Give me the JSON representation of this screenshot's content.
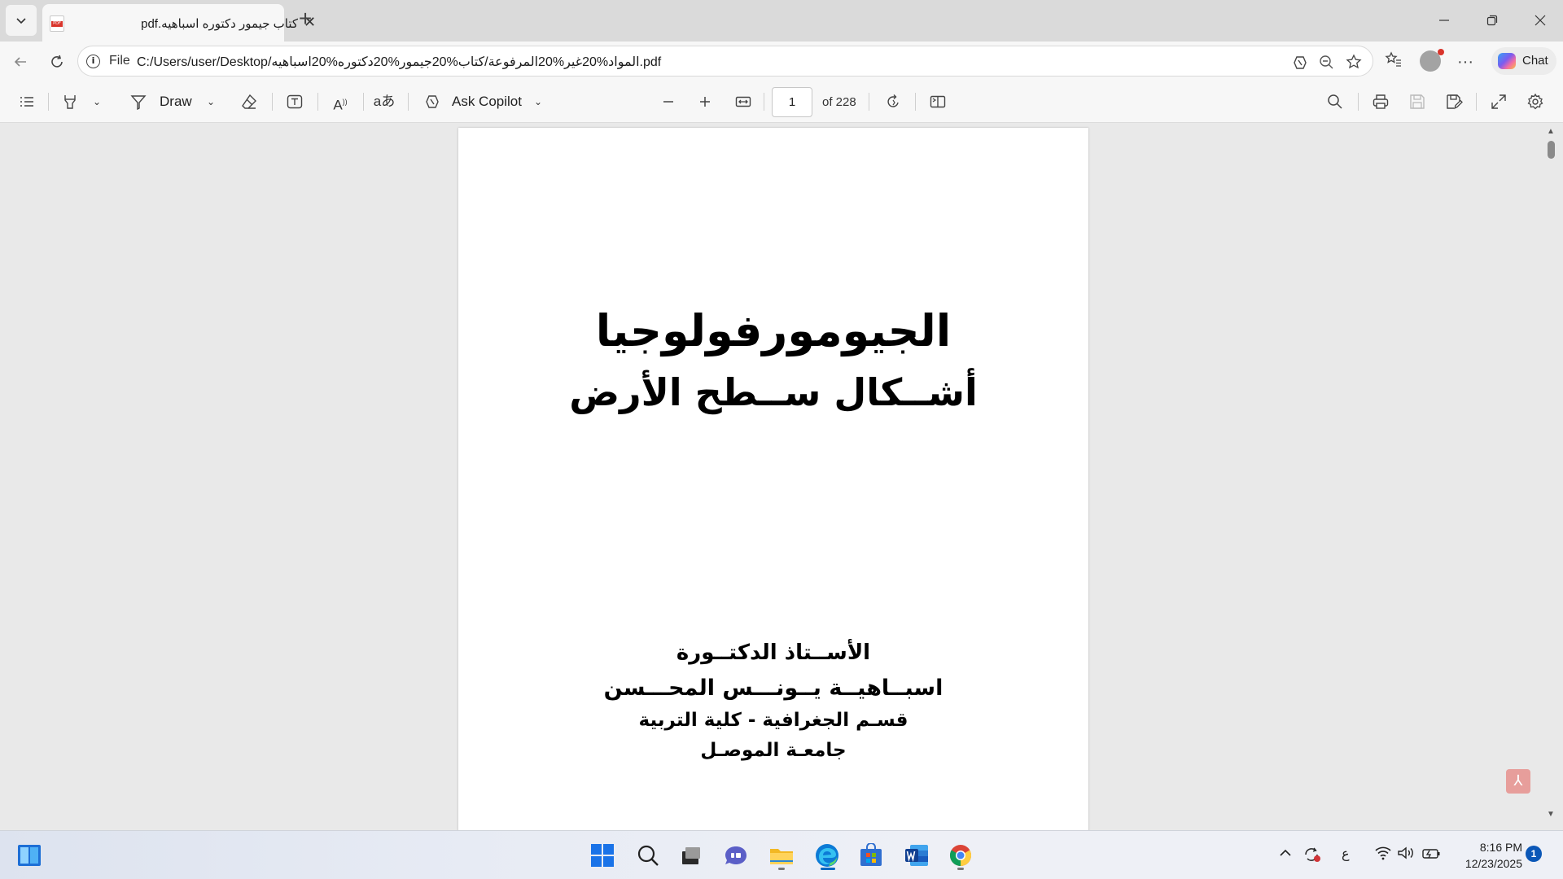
{
  "browser": {
    "tab": {
      "title": "كتاب جيمور دكتوره اسباهيه.pdf"
    },
    "address": {
      "scheme_label": "File",
      "url": "C:/Users/user/Desktop/المواد%20غير%20المرفوعة/كتاب%20جيمور%20دكتوره%20اسباهيه.pdf"
    },
    "chat_label": "Chat"
  },
  "pdf_toolbar": {
    "draw_label": "Draw",
    "ask_copilot_label": "Ask Copilot",
    "page_current": "1",
    "page_total_label": "of 228"
  },
  "document": {
    "title_main": "الجيومورفولوجيا",
    "title_sub": "أشــكال ســطح الأرض",
    "author_role": "الأســتاذ الدكتــورة",
    "author_name": "اسبــاهيــة يــونـــس المحـــسن",
    "department": "قسـم الجغرافية - كلية التربية",
    "university": "جامعـة الموصـل"
  },
  "taskbar": {
    "apps": [
      "widgets",
      "start",
      "search",
      "task-view",
      "teams",
      "file-explorer",
      "edge",
      "store",
      "word",
      "chrome"
    ],
    "active_app": "edge",
    "tray": {
      "input_language": "ع"
    },
    "clock": {
      "time": "8:16 PM",
      "date": "12/23/2025"
    },
    "notification_count": "1"
  },
  "colors": {
    "accent": "#0067c0",
    "pdf_red": "#d9342b",
    "titlebar": "#dadada",
    "toolbar": "#f7f7f7",
    "viewer_bg": "#e9e9e9"
  }
}
